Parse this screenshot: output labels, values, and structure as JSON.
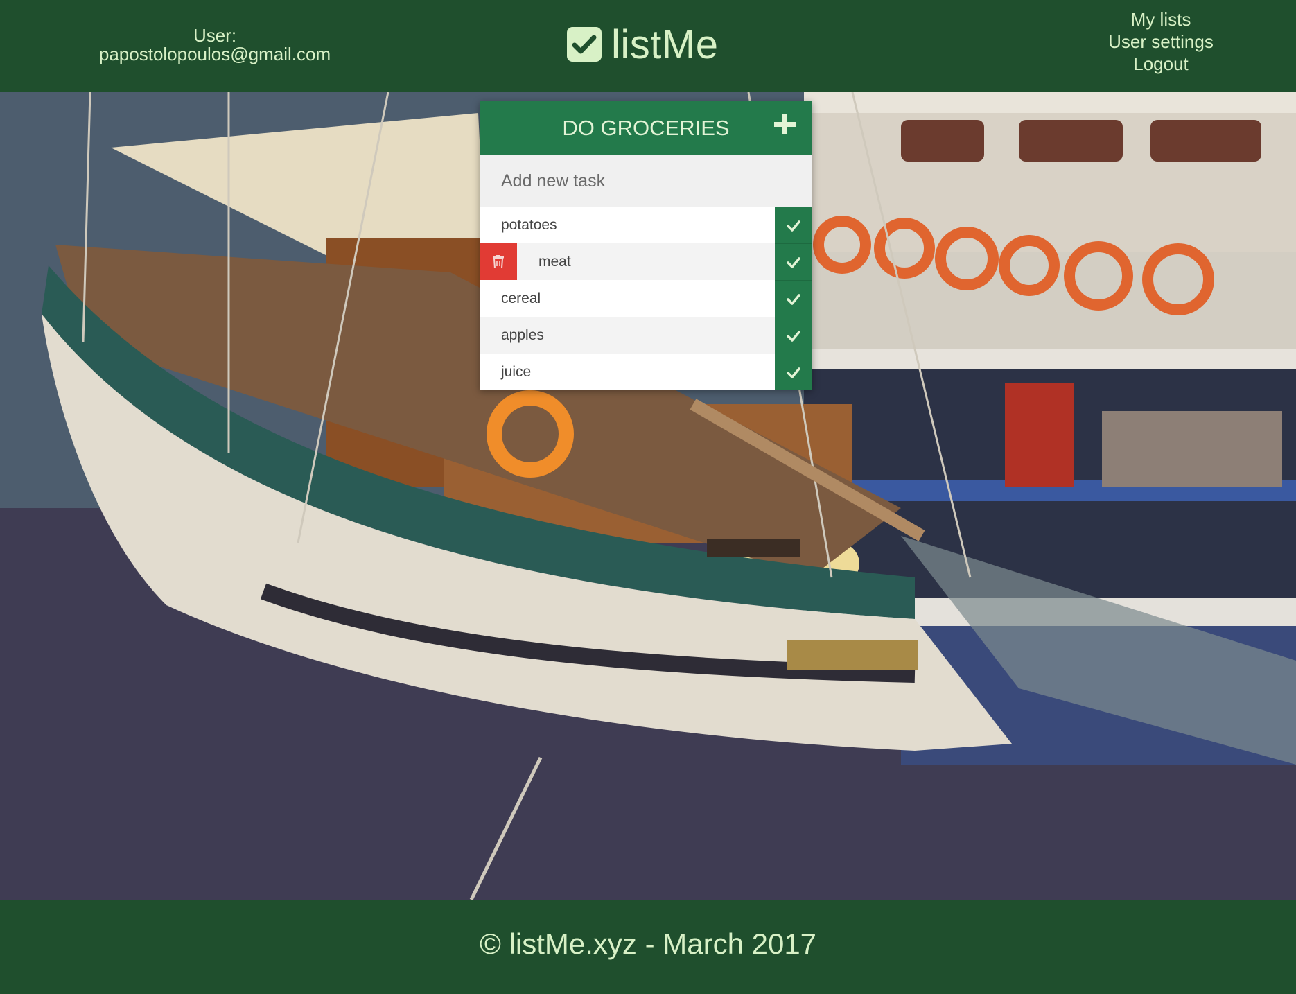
{
  "header": {
    "user_label": "User:",
    "user_email": "papostolopoulos@gmail.com",
    "brand": "listMe",
    "nav": {
      "my_lists": "My lists",
      "user_settings": "User settings",
      "logout": "Logout"
    }
  },
  "list": {
    "title": "DO GROCERIES",
    "add_icon": "plus-icon",
    "new_task_placeholder": "Add new task",
    "tasks": [
      {
        "label": "potatoes"
      },
      {
        "label": "meat"
      },
      {
        "label": "cereal"
      },
      {
        "label": "apples"
      },
      {
        "label": "juice"
      }
    ]
  },
  "footer": {
    "text": "© listMe.xyz - March 2017"
  },
  "colors": {
    "bar": "#1f4f2d",
    "accent_green": "#237a4b",
    "brand_text": "#d8f1c6",
    "delete_red": "#e13b34"
  }
}
